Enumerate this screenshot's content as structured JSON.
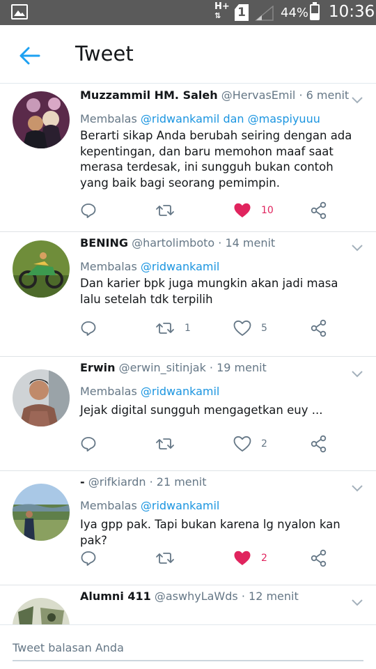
{
  "status_bar": {
    "network": "H+",
    "sim": "1",
    "battery_percent": "44%",
    "battery_level": 0.44,
    "time": "10:36"
  },
  "app_bar": {
    "title": "Tweet",
    "back_icon": "arrow-left-icon"
  },
  "reply_prefix": "Membalas",
  "tweets": [
    {
      "name": "Muzzammil HM. Saleh",
      "handle": "@HervasEmil",
      "time": "· 6 menit",
      "reply_to": "@ridwankamil dan @maspiyuuu",
      "text": "Berarti sikap Anda berubah seiring dengan ada kepentingan, dan baru memohon maaf saat merasa terdesak, ini sungguh bukan contoh yang baik bagi seorang pemimpin.",
      "retweets": "",
      "likes": "10",
      "liked": true
    },
    {
      "name": "BENING",
      "handle": "@hartolimboto",
      "time": "· 14 menit",
      "reply_to": "@ridwankamil",
      "text": "Dan karier bpk juga mungkin akan jadi masa lalu setelah tdk terpilih",
      "retweets": "1",
      "likes": "5",
      "liked": false
    },
    {
      "name": "Erwin",
      "handle": "@erwin_sitinjak",
      "time": "· 19 menit",
      "reply_to": "@ridwankamil",
      "text": "Jejak digital sungguh mengagetkan euy ...",
      "retweets": "",
      "likes": "2",
      "liked": false
    },
    {
      "name": "-",
      "handle": "@rifkiardn",
      "time": "· 21 menit",
      "reply_to": "@ridwankamil",
      "text": "Iya gpp pak. Tapi bukan karena lg nyalon kan pak?",
      "retweets": "",
      "likes": "2",
      "liked": true
    },
    {
      "name": "Alumni 411",
      "handle": "@aswhyLaWds",
      "time": "· 12 menit",
      "reply_to": "",
      "text": "",
      "retweets": "",
      "likes": "",
      "liked": false
    }
  ],
  "reply_bar": {
    "placeholder": "Tweet balasan Anda"
  },
  "colors": {
    "accent": "#1da1f2",
    "mention": "#1b95e0",
    "like": "#e0245e",
    "muted": "#657786",
    "status_bar": "#5a5a5a"
  }
}
